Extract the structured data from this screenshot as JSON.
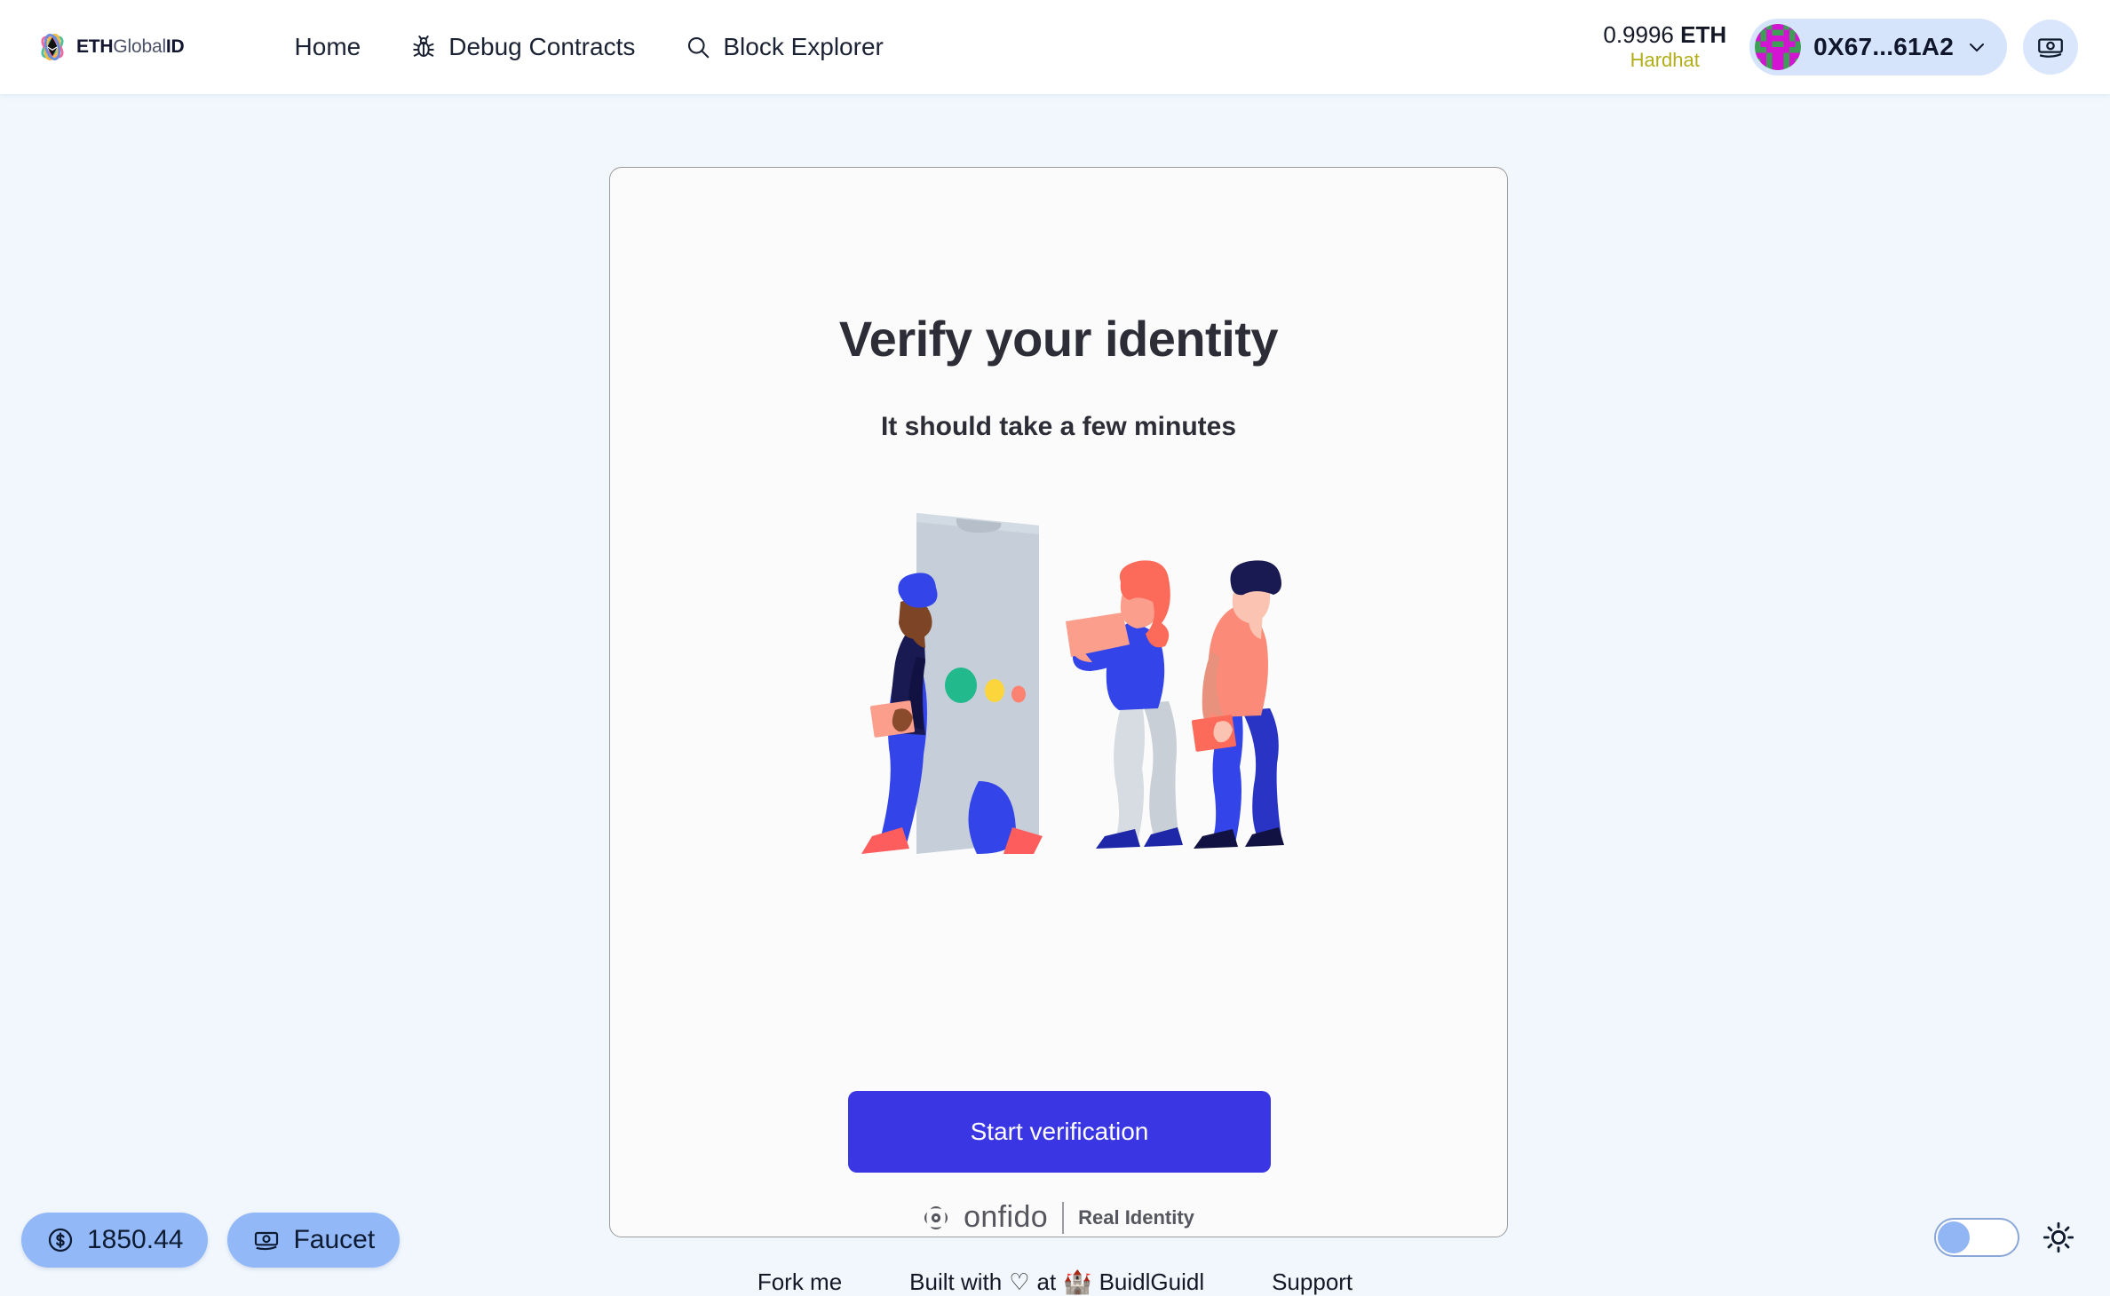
{
  "header": {
    "brand": {
      "part1": "ETH",
      "part2": "Global",
      "part3": "ID",
      "icon": "ethglobal-logo-icon"
    },
    "nav": [
      {
        "label": "Home",
        "icon": null
      },
      {
        "label": "Debug Contracts",
        "icon": "bug-icon"
      },
      {
        "label": "Block Explorer",
        "icon": "search-icon"
      }
    ],
    "balance": {
      "amount": "0.9996",
      "symbol": "ETH",
      "network": "Hardhat",
      "network_color": "#b3ad18"
    },
    "account": {
      "address": "0X67...61A2",
      "avatar": "blockie-avatar",
      "chevron": "chevron-down-icon"
    },
    "faucet_icon_button": "banknote-icon"
  },
  "card": {
    "title": "Verify your identity",
    "subtitle": "It should take a few minutes",
    "illustration": "people-with-phone-illustration",
    "start_button": "Start verification",
    "provider": {
      "name": "onfido",
      "tagline": "Real Identity",
      "mark": "onfido-mark-icon"
    }
  },
  "floating": {
    "price_pill": {
      "value": "1850.44",
      "icon": "dollar-circle-icon"
    },
    "faucet_pill": {
      "label": "Faucet",
      "icon": "banknote-icon"
    },
    "theme": {
      "toggle_state": "off",
      "icon": "sun-icon"
    }
  },
  "footer": {
    "fork": "Fork me",
    "built_prefix": "Built with",
    "built_heart": "♡",
    "built_at": "at",
    "built_castle": "🏰",
    "built_name": "BuidlGuidl",
    "support": "Support"
  },
  "colors": {
    "page_bg": "#f1f7fd",
    "card_bg": "#fbfbfb",
    "accent": "#3a36e4",
    "pill_bg": "#93b8f7",
    "addr_pill_bg": "#d5e3fb"
  }
}
